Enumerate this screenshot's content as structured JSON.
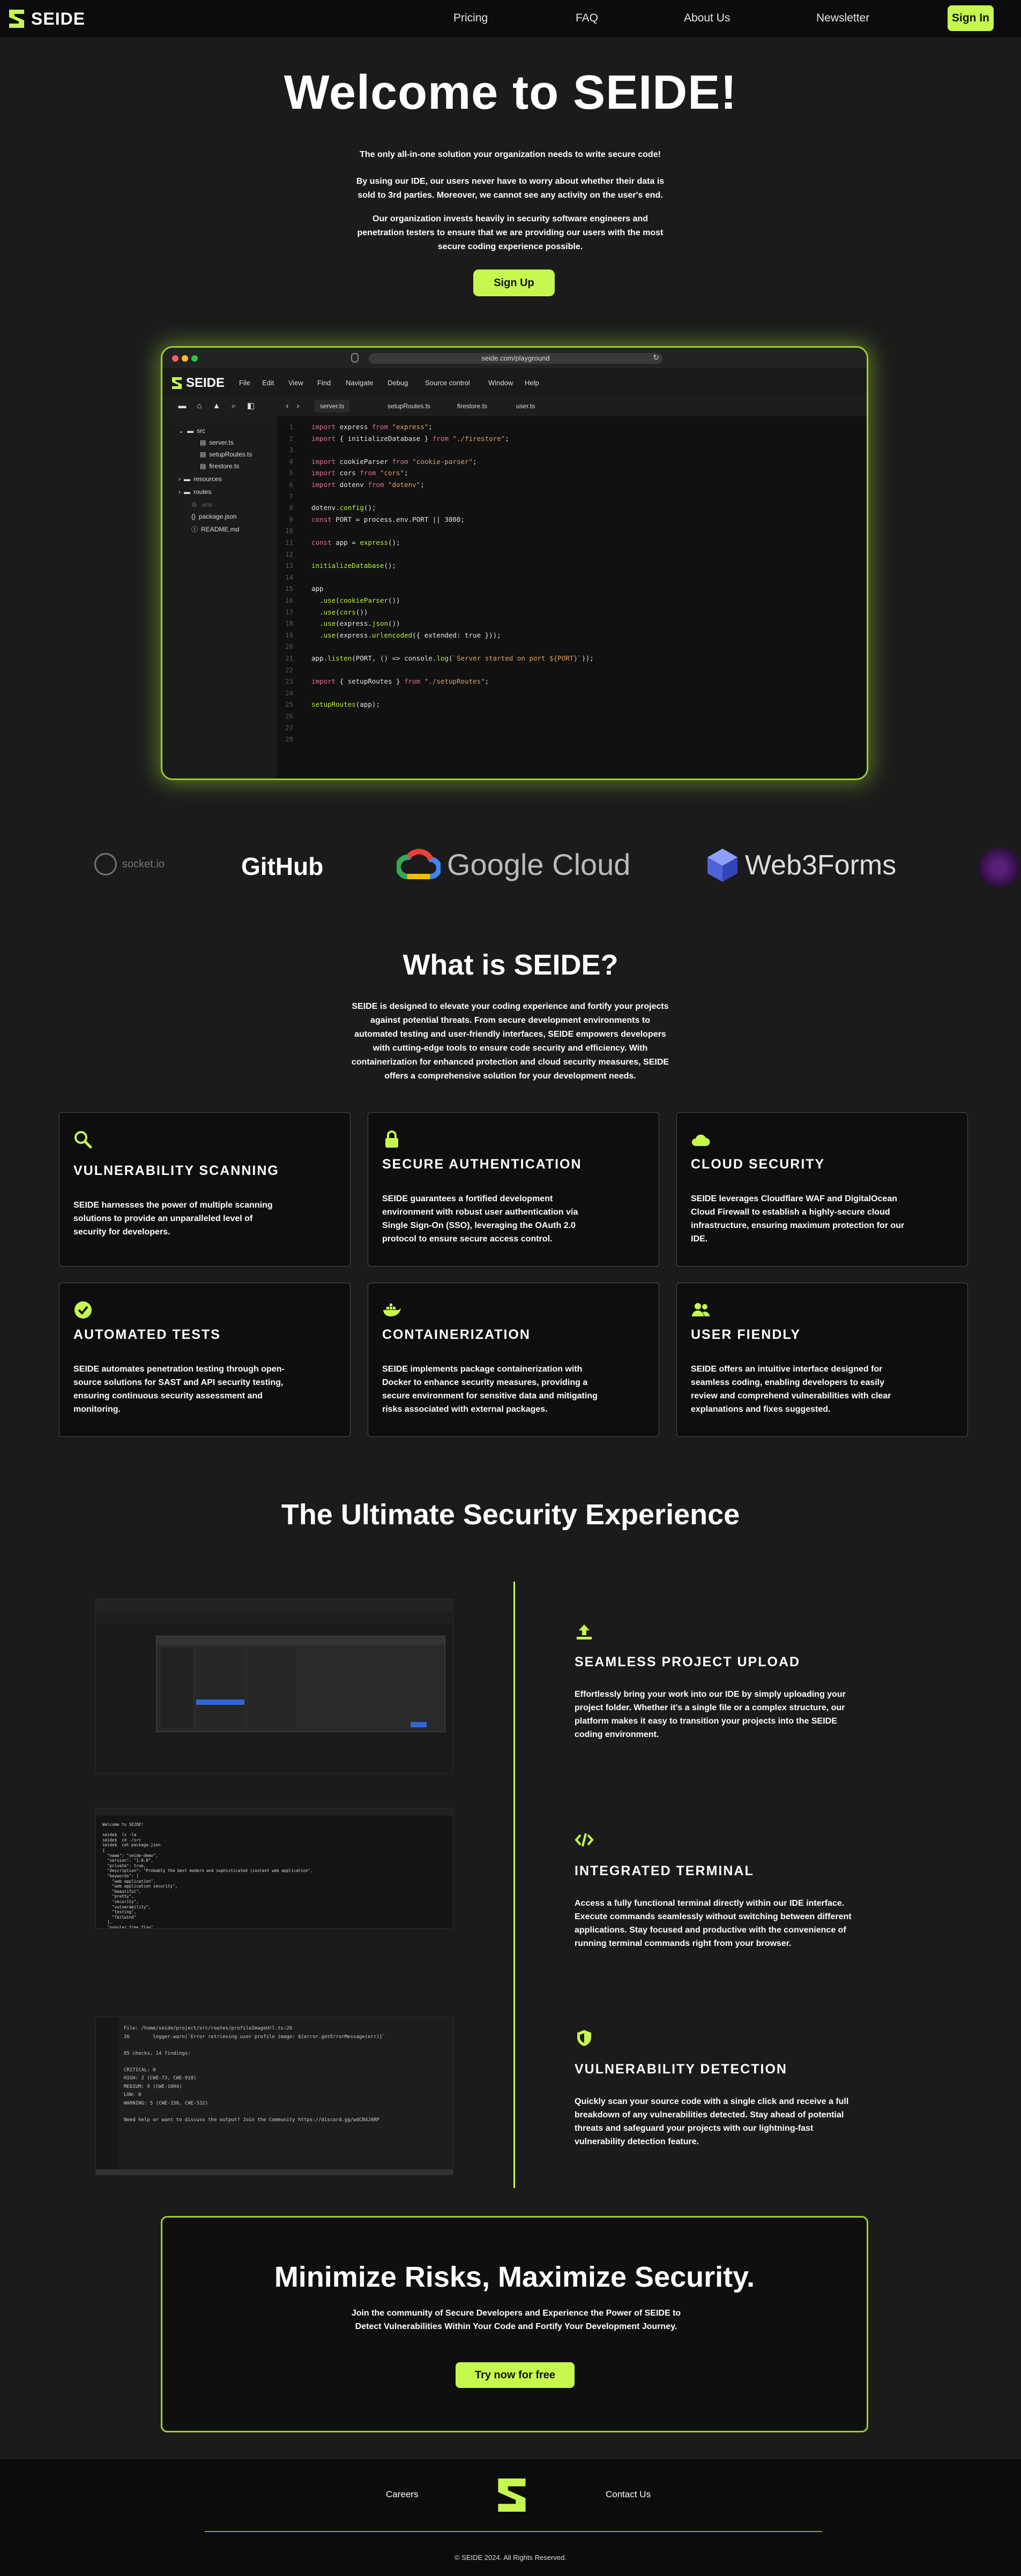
{
  "nav": {
    "brand": "SEIDE",
    "links": [
      "Pricing",
      "FAQ",
      "About Us",
      "Newsletter"
    ],
    "signin": "Sign In"
  },
  "hero": {
    "title": "Welcome to SEIDE!",
    "p1": "The only all-in-one solution your organization needs to write secure code!",
    "p2": "By using our IDE, our users never have to worry about whether their data is sold to 3rd parties. Moreover, we cannot see any activity on the user's end.",
    "p3": "Our organization invests heavily in security software engineers and penetration testers to ensure that we are providing our users with the most secure coding experience possible.",
    "cta": "Sign Up"
  },
  "ide": {
    "url": "seide.com/playground",
    "brand": "SEIDE",
    "menu": [
      "File",
      "Edit",
      "View",
      "Find",
      "Navigate",
      "Debug",
      "Source control",
      "Window",
      "Help"
    ],
    "tabs": [
      "server.ts",
      "setupRoutes.ts",
      "firestore.ts",
      "user.ts"
    ],
    "tree": [
      {
        "label": "src",
        "kind": "folder-open"
      },
      {
        "label": "server.ts",
        "kind": "file"
      },
      {
        "label": "setupRoutes.ts",
        "kind": "file"
      },
      {
        "label": "firestore.ts",
        "kind": "file"
      },
      {
        "label": "resources",
        "kind": "folder"
      },
      {
        "label": "routes",
        "kind": "folder"
      },
      {
        "label": ".env",
        "kind": "dim"
      },
      {
        "label": "package.json",
        "kind": "file"
      },
      {
        "label": "README.md",
        "kind": "file"
      }
    ],
    "code": [
      "import express from \"express\";",
      "import { initializeDatabase } from \"./firestore\";",
      "",
      "import cookieParser from \"cookie-parser\";",
      "import cors from \"cors\";",
      "import dotenv from \"dotenv\";",
      "",
      "dotenv.config();",
      "const PORT = process.env.PORT || 3000;",
      "",
      "const app = express();",
      "",
      "initializeDatabase();",
      "",
      "app",
      "  .use(cookieParser())",
      "  .use(cors())",
      "  .use(express.json())",
      "  .use(express.urlencoded({ extended: true }));",
      "",
      "app.listen(PORT, () => console.log(`Server started on port ${PORT}`));",
      "",
      "import { setupRoutes } from \"./setupRoutes\";",
      "",
      "setupRoutes(app);",
      "",
      "",
      ""
    ]
  },
  "logos": [
    "socket.io",
    "GitHub",
    "Google Cloud",
    "Web3Forms"
  ],
  "what": {
    "title": "What is SEIDE?",
    "desc": "SEIDE is designed to elevate your coding experience and fortify your projects against potential threats. From secure development environments to automated testing and user-friendly interfaces, SEIDE empowers developers with cutting-edge tools to ensure code security and efficiency. With containerization for enhanced protection and cloud security measures, SEIDE offers a comprehensive solution for your development needs.",
    "cards": [
      {
        "icon": "magnifier-icon",
        "title": "VULNERABILITY SCANNING",
        "desc": "SEIDE harnesses the power of multiple scanning solutions to provide an unparalleled level of security for developers."
      },
      {
        "icon": "lock-icon",
        "title": "SECURE AUTHENTICATION",
        "desc": "SEIDE guarantees a fortified development environment with robust user authentication via Single Sign-On (SSO), leveraging the OAuth 2.0 protocol to ensure secure access control."
      },
      {
        "icon": "cloud-icon",
        "title": "CLOUD SECURITY",
        "desc": "SEIDE leverages Cloudflare WAF and DigitalOcean Cloud Firewall to establish a highly-secure cloud infrastructure, ensuring maximum protection for our IDE."
      },
      {
        "icon": "check-circle-icon",
        "title": "AUTOMATED TESTS",
        "desc": "SEIDE automates penetration testing through open-source solutions for SAST and API security testing, ensuring continuous security assessment and monitoring."
      },
      {
        "icon": "docker-icon",
        "title": "CONTAINERIZATION",
        "desc": "SEIDE implements package containerization with Docker to enhance security measures, providing a secure environment for sensitive data and mitigating risks associated with external packages."
      },
      {
        "icon": "users-icon",
        "title": "USER FIENDLY",
        "desc": "SEIDE offers an intuitive interface designed for seamless coding, enabling developers to easily review and comprehend vulnerabilities with clear explanations and fixes suggested."
      }
    ]
  },
  "ultimate": {
    "title": "The Ultimate Security Experience",
    "features": [
      {
        "icon": "upload-icon",
        "title": "SEAMLESS PROJECT UPLOAD",
        "desc": "Effortlessly bring your work into our IDE by simply uploading your project folder. Whether it's a single file or a complex structure, our platform makes it easy to transition your projects into the SEIDE coding environment."
      },
      {
        "icon": "code-icon",
        "title": "INTEGRATED TERMINAL",
        "desc": "Access a fully functional terminal directly within our IDE interface. Execute commands seamlessly without switching between different applications. Stay focused and productive with the convenience of running terminal commands right from your browser."
      },
      {
        "icon": "shield-icon",
        "title": "VULNERABILITY DETECTION",
        "desc": "Quickly scan your source code with a single click and receive a full breakdown of any vulnerabilities detected. Stay ahead of potential threats and safeguard your projects with our lightning-fast vulnerability detection feature."
      }
    ],
    "terminal_lines": [
      "Welcome to SEIDE!",
      "",
      "seide$  ls -la",
      "seide$  cd ./src",
      "seide$  cat package.json",
      "{",
      "  \"name\": \"seide-demo\",",
      "  \"version\": \"1.0.0\",",
      "  \"private\": true,",
      "  \"description\": \"Probably the best modern and sophisticated (coolest web application\",",
      "  \"keywords\": [",
      "    \"web application\",",
      "    \"web application security\",",
      "    \"beautiful\",",
      "    \"pretty\",",
      "    \"security\",",
      "    \"vulnerability\",",
      "    \"testing\",",
      "    \"Tailwind\"",
      "  ],",
      "  \"popular free flow\","
    ],
    "scan_lines": [
      "File: /home/seide/project/src/routes/profileImageUrl.ts:26",
      "26        logger.warn(`Error retrieving user profile image: ${error.getErrorMessage(err)}`",
      "",
      "85 checks, 14 findings:",
      "",
      "CRITICAL: 0",
      "HIGH: 2 (CWE-73, CWE-918)",
      "MEDIUM: 9 (CWE-1004)",
      "LOW: 0",
      "WARNING: 5 (CWE-338, CWE-532)",
      "",
      "Need help or want to discuss the output? Join the Community https://discord.gg/wdCB4JARP"
    ]
  },
  "cta": {
    "title": "Minimize Risks, Maximize Security.",
    "desc": "Join the community of Secure Developers and Experience the Power of SEIDE to Detect Vulnerabilities Within Your Code and Fortify Your Development Journey.",
    "button": "Try now for free"
  },
  "footer": {
    "careers": "Careers",
    "contact": "Contact Us",
    "copyright": "© SEIDE 2024. All Rights Reserved."
  },
  "colors": {
    "accent": "#c6f84e",
    "bg": "#1b1b1b",
    "card": "#0e0e0e"
  }
}
